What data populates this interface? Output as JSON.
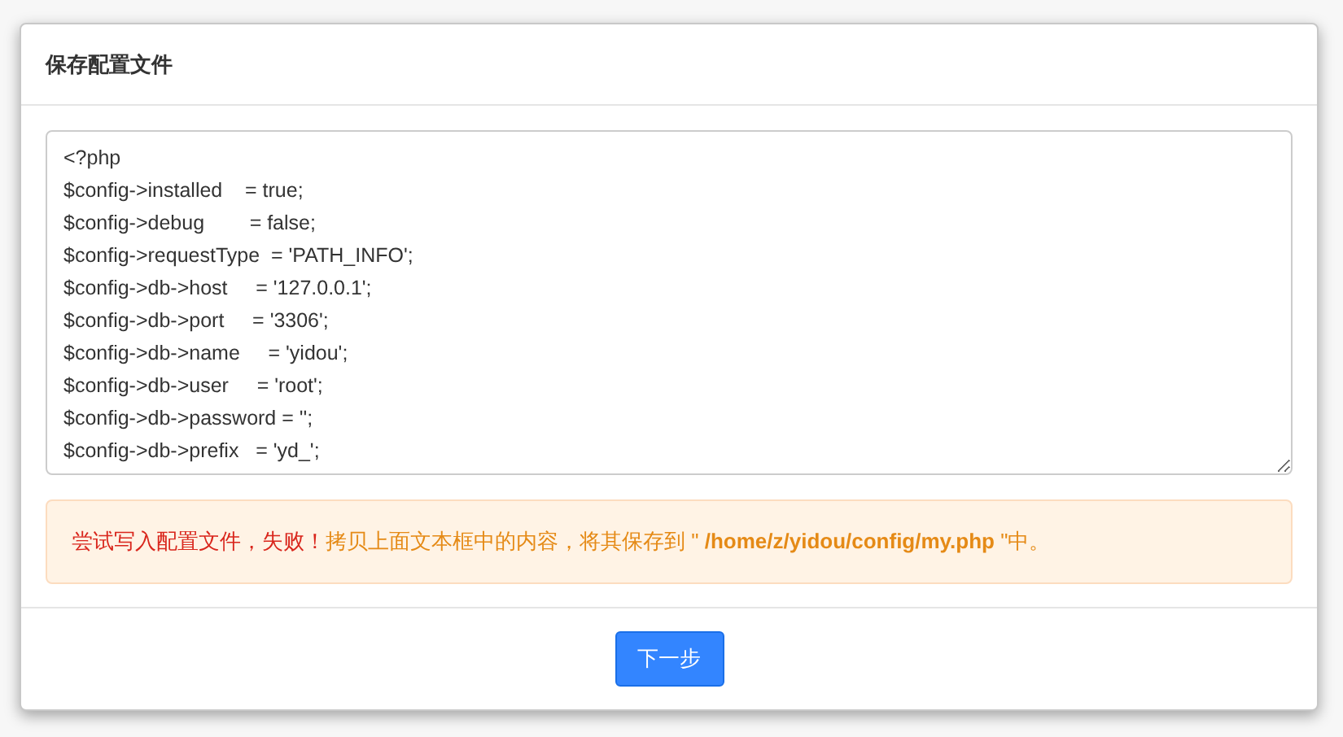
{
  "dialog": {
    "title": "保存配置文件"
  },
  "config_text": [
    "<?php",
    "$config->installed    = true;",
    "$config->debug        = false;",
    "$config->requestType  = 'PATH_INFO';",
    "$config->db->host     = '127.0.0.1';",
    "$config->db->port     = '3306';",
    "$config->db->name     = 'yidou';",
    "$config->db->user     = 'root';",
    "$config->db->password = '';",
    "$config->db->prefix   = 'yd_';"
  ],
  "alert": {
    "error": "尝试写入配置文件，失败！",
    "instruction": "拷贝上面文本框中的内容，将其保存到 \" **/home/z/yidou/config/my.php** \"中。"
  },
  "buttons": [
    {
      "label": "下一步",
      "kind": "primary"
    }
  ]
}
